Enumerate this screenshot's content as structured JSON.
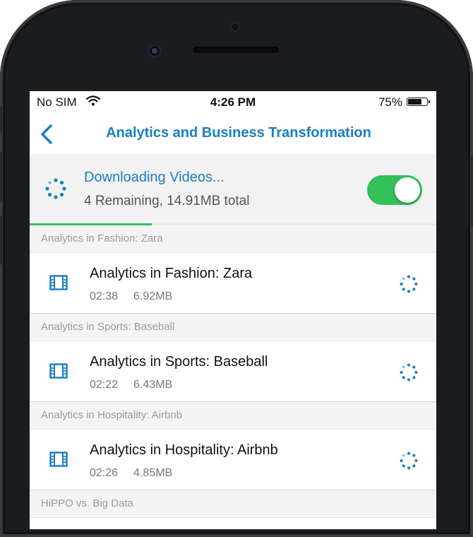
{
  "status_bar": {
    "carrier": "No SIM",
    "wifi_icon": "wifi-icon",
    "time": "4:26 PM",
    "battery_pct": "75%",
    "battery_level": 0.75
  },
  "nav": {
    "back_icon": "chevron-left-icon",
    "title": "Analytics and Business Transformation"
  },
  "download": {
    "title": "Downloading Videos...",
    "subtitle": "4 Remaining, 14.91MB total",
    "toggle_on": true,
    "progress": 0.3
  },
  "sections": [
    {
      "header": "Analytics in Fashion: Zara",
      "video": {
        "title": "Analytics in Fashion: Zara",
        "duration": "02:38",
        "size": "6.92MB"
      }
    },
    {
      "header": "Analytics in Sports: Baseball",
      "video": {
        "title": "Analytics in Sports: Baseball",
        "duration": "02:22",
        "size": "6.43MB"
      }
    },
    {
      "header": "Analytics in Hospitality: Airbnb",
      "video": {
        "title": "Analytics in Hospitality: Airbnb",
        "duration": "02:26",
        "size": "4.85MB"
      }
    },
    {
      "header": "HiPPO vs. Big Data"
    }
  ],
  "colors": {
    "accent": "#1a7fbf",
    "toggle_green": "#33c15a",
    "frame": "#1b1c1f"
  }
}
